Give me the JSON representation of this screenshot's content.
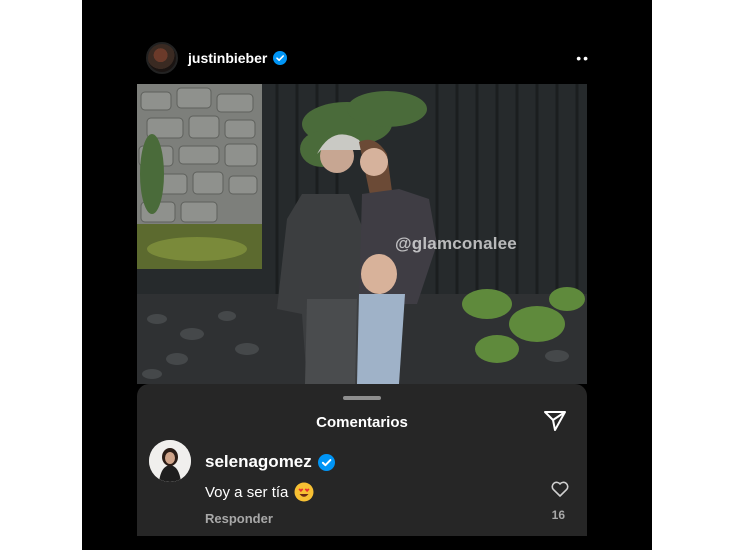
{
  "post": {
    "username": "justinbieber",
    "more_label": "••",
    "watermark": "@glamconalee"
  },
  "comments_sheet": {
    "title": "Comentarios",
    "comment": {
      "username": "selenagomez",
      "text": "Voy a ser tía",
      "reply_label": "Responder",
      "like_count": "16"
    }
  },
  "icons": {
    "verified": "verified-badge-icon",
    "more": "more-options-icon",
    "send": "paper-plane-icon",
    "like": "heart-icon",
    "emoji": "heart-eyes-emoji-icon"
  },
  "colors": {
    "background": "#000000",
    "sheet": "#262626",
    "verified_blue": "#0095f6",
    "muted_text": "#a8a8a8"
  }
}
